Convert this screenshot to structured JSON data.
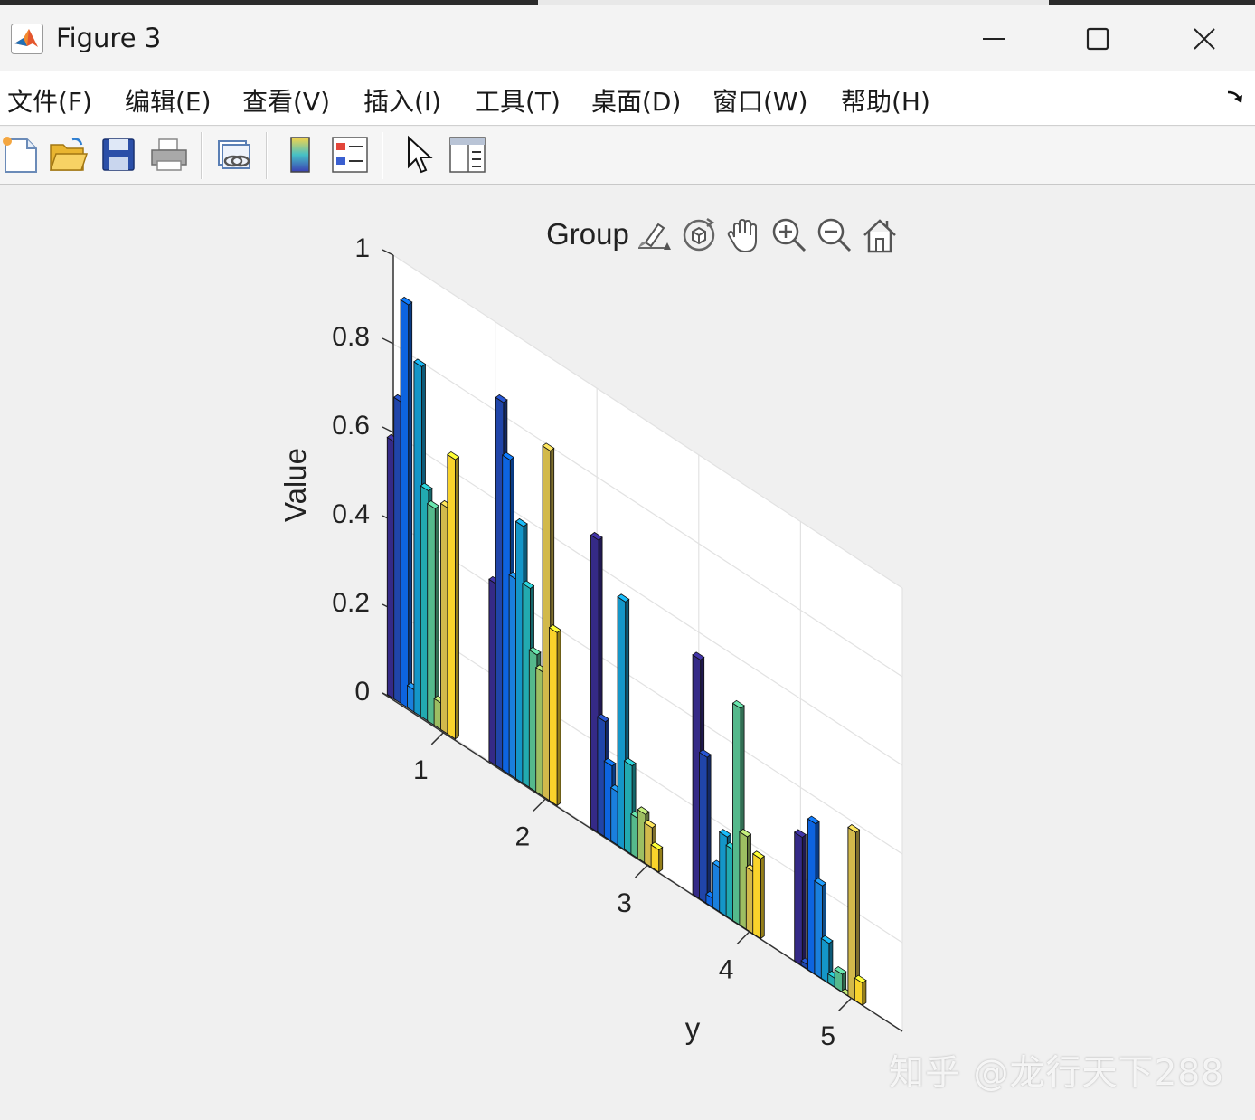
{
  "window": {
    "title": "Figure 3",
    "minimize_icon": "minimize-icon",
    "maximize_icon": "maximize-icon",
    "close_icon": "close-icon"
  },
  "menu": {
    "items": [
      {
        "label": "文件(F)"
      },
      {
        "label": "编辑(E)"
      },
      {
        "label": "查看(V)"
      },
      {
        "label": "插入(I)"
      },
      {
        "label": "工具(T)"
      },
      {
        "label": "桌面(D)"
      },
      {
        "label": "窗口(W)"
      },
      {
        "label": "帮助(H)"
      }
    ]
  },
  "toolbar": {
    "buttons": [
      "new-file-icon",
      "open-folder-icon",
      "save-icon",
      "print-icon",
      "link-figure-icon",
      "colorbar-icon",
      "legend-icon",
      "pointer-icon",
      "property-inspector-icon"
    ]
  },
  "axes_toolbar": {
    "buttons": [
      "brush-icon",
      "rotate-3d-icon",
      "pan-icon",
      "zoom-in-icon",
      "zoom-out-icon",
      "home-icon"
    ]
  },
  "watermark": "知乎 @龙行天下288",
  "chart_data": {
    "type": "bar3",
    "title": "Group",
    "zlabel": "Value",
    "ylabel": "y",
    "zlim": [
      0,
      1
    ],
    "z_ticks": [
      "0",
      "0.2",
      "0.4",
      "0.6",
      "0.8",
      "1"
    ],
    "y_ticks": [
      "1",
      "2",
      "3",
      "4",
      "5"
    ],
    "grid": true,
    "colormap": "parula",
    "groups": [
      {
        "y": 1,
        "values": [
          0.58,
          0.68,
          0.91,
          0.05,
          0.79,
          0.52,
          0.49,
          0.06,
          0.51,
          0.63
        ]
      },
      {
        "y": 2,
        "values": [
          0.41,
          0.83,
          0.71,
          0.45,
          0.58,
          0.45,
          0.31,
          0.28,
          0.79,
          0.39
        ]
      },
      {
        "y": 3,
        "values": [
          0.66,
          0.26,
          0.17,
          0.12,
          0.56,
          0.2,
          0.09,
          0.11,
          0.09,
          0.05
        ]
      },
      {
        "y": 4,
        "values": [
          0.54,
          0.33,
          0.02,
          0.1,
          0.18,
          0.16,
          0.49,
          0.21,
          0.14,
          0.18
        ]
      },
      {
        "y": 5,
        "values": [
          0.29,
          0.01,
          0.34,
          0.21,
          0.09,
          0.02,
          0.04,
          0.0,
          0.38,
          0.05
        ]
      }
    ]
  }
}
